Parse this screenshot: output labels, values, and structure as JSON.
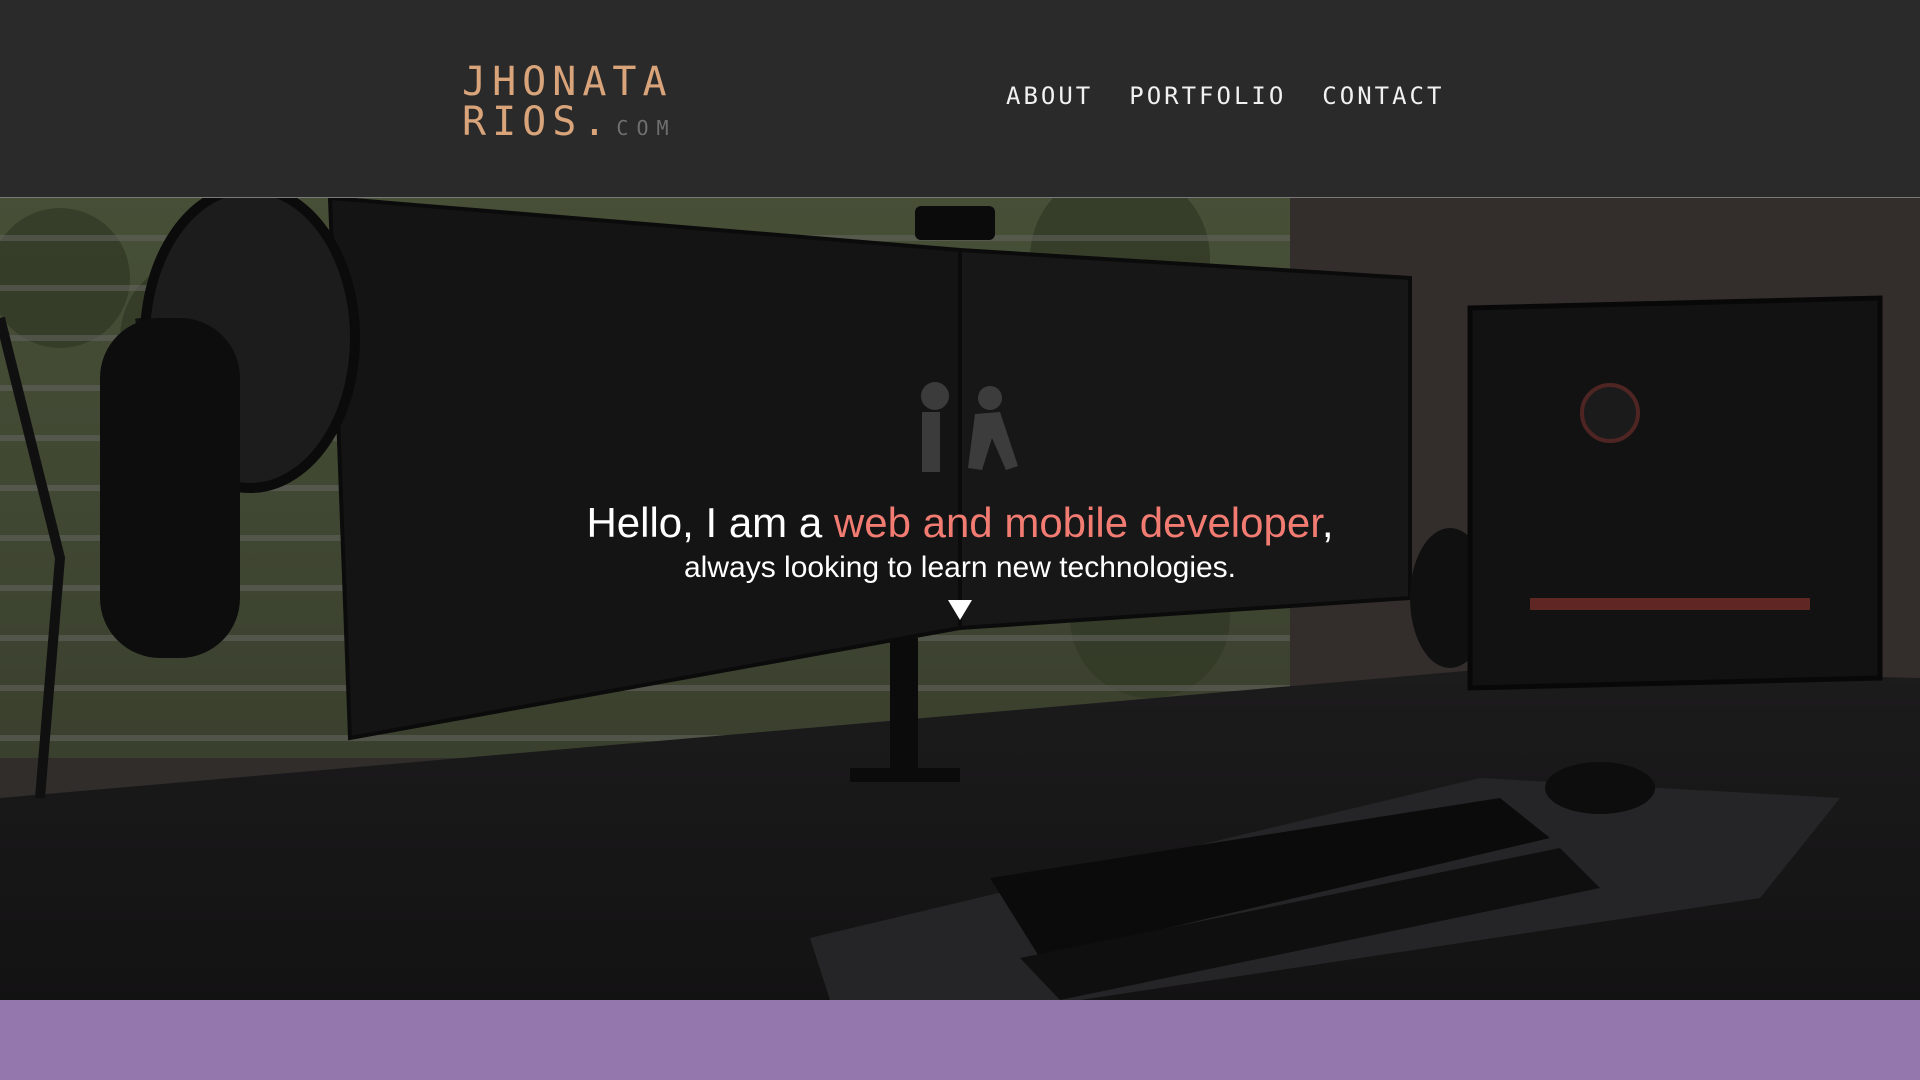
{
  "brand": {
    "line1": "JHONATA",
    "line2": "RIOS",
    "dot": ".",
    "suffix": "COM",
    "color": "#d9a47a"
  },
  "nav": {
    "items": [
      {
        "label": "ABOUT"
      },
      {
        "label": "PORTFOLIO"
      },
      {
        "label": "CONTACT"
      }
    ]
  },
  "hero": {
    "greeting": "Hello, I am a ",
    "highlight": "web and mobile developer",
    "comma": ",",
    "subline": "always looking to learn new technologies.",
    "accent_color": "#f27b72",
    "scroll_icon": "caret-down-icon"
  },
  "colors": {
    "header_bg": "#2a2a2b",
    "band": "#9377ad"
  }
}
